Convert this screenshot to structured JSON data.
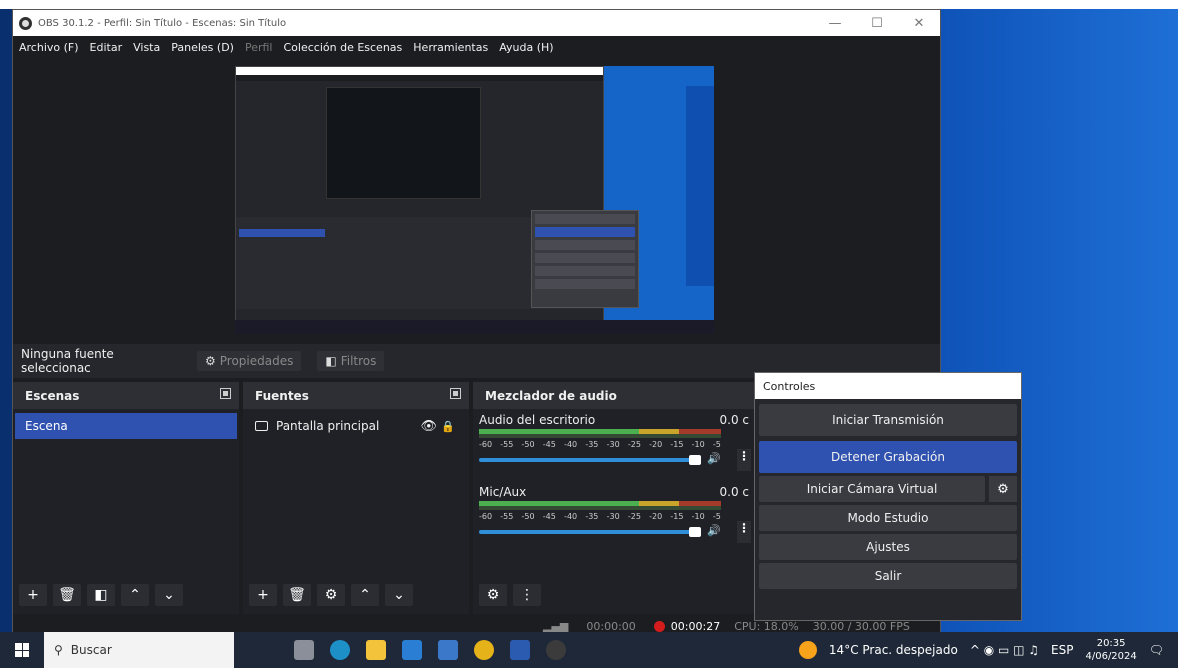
{
  "window": {
    "title": "OBS 30.1.2 - Perfil: Sin Título - Escenas: Sin Título",
    "controls": [
      "—",
      "☐",
      "✕"
    ]
  },
  "menu": [
    "Archivo (F)",
    "Editar",
    "Vista",
    "Paneles (D)",
    "Perfil",
    "Colección de Escenas",
    "Herramientas",
    "Ayuda (H)"
  ],
  "source_bar": {
    "no_selection": "Ninguna fuente seleccionac",
    "properties": "Propiedades",
    "filters": "Filtros"
  },
  "scenes": {
    "title": "Escenas",
    "items": [
      "Escena"
    ]
  },
  "sources": {
    "title": "Fuentes",
    "items": [
      "Pantalla principal"
    ]
  },
  "mixer": {
    "title": "Mezclador de audio",
    "ticks": [
      "-60",
      "-55",
      "-50",
      "-45",
      "-40",
      "-35",
      "-30",
      "-25",
      "-20",
      "-15",
      "-10",
      "-5"
    ],
    "channels": [
      {
        "name": "Audio del escritorio",
        "level": "0.0 c"
      },
      {
        "name": "Mic/Aux",
        "level": "0.0 c"
      }
    ]
  },
  "controls": {
    "title": "Controles",
    "start_stream": "Iniciar Transmisión",
    "stop_record": "Detener Grabación",
    "virtual_cam": "Iniciar Cámara Virtual",
    "studio_mode": "Modo Estudio",
    "settings": "Ajustes",
    "exit": "Salir"
  },
  "status": {
    "stream_time": "00:00:00",
    "rec_time": "00:00:27",
    "cpu": "CPU: 18.0%",
    "fps": "30.00 / 30.00 FPS"
  },
  "taskbar": {
    "search": "Buscar",
    "weather": "14°C  Prac. despejado",
    "lang": "ESP",
    "time": "20:35",
    "date": "4/06/2024"
  },
  "colors": {
    "accent": "#2f52b0",
    "record": "#d41c1c",
    "meter_green": "#4caf50"
  }
}
